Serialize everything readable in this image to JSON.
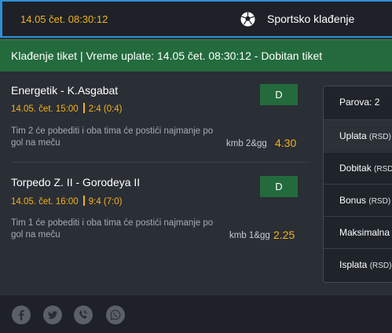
{
  "topbar": {
    "datetime": "14.05 čet. 08:30:12",
    "section_icon": "soccer-ball-icon",
    "section_label": "Sportsko klađenje"
  },
  "ticket": {
    "header": "Klađenje tiket | Vreme uplate: 14.05 čet. 08:30:12 - Dobitan tiket"
  },
  "matches": [
    {
      "teams": "Energetik - K.Asgabat",
      "date": "14.05. čet. 15:00",
      "score": "2:4 (0:4)",
      "description": "Tim 2 će pobediti i oba tima će postići najmanje po gol na meču",
      "market": "kmb 2&gg",
      "odd": "4.30",
      "pick": "D"
    },
    {
      "teams": "Torpedo Z. II - Gorodeya II",
      "date": "14.05. čet. 16:00",
      "score": "9:4 (7:0)",
      "description": "Tim 1 će pobediti i oba tima će postići najmanje po gol na meču",
      "market": "kmb 1&gg",
      "odd": "2.25",
      "pick": "D"
    }
  ],
  "summary": {
    "pairs": "Parova: 2",
    "payment": "Uplata",
    "payment_unit": "(RSD)",
    "win": "Dobitak",
    "win_unit": "(RSD",
    "bonus": "Bonus",
    "bonus_unit": "(RSD)",
    "max": "Maksimalna i",
    "payout": "Isplata",
    "payout_unit": "(RSD)"
  },
  "footer": {
    "icons": [
      "facebook-icon",
      "twitter-icon",
      "viber-icon",
      "whatsapp-icon"
    ]
  },
  "colors": {
    "accent": "#f3b21c",
    "green": "#236b3d",
    "blue": "#2f8fd8"
  }
}
